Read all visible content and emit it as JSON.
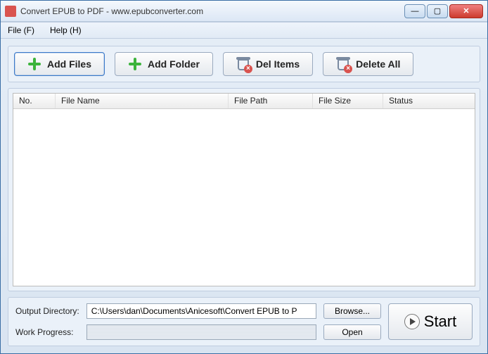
{
  "window": {
    "title": "Convert EPUB to PDF - www.epubconverter.com"
  },
  "menu": {
    "file": "File (F)",
    "help": "Help (H)"
  },
  "toolbar": {
    "add_files": "Add Files",
    "add_folder": "Add Folder",
    "del_items": "Del Items",
    "delete_all": "Delete All"
  },
  "table": {
    "headers": {
      "no": "No.",
      "name": "File Name",
      "path": "File Path",
      "size": "File Size",
      "status": "Status"
    },
    "rows": []
  },
  "bottom": {
    "output_dir_label": "Output Directory:",
    "output_dir_value": "C:\\Users\\dan\\Documents\\Anicesoft\\Convert EPUB to P",
    "browse": "Browse...",
    "work_progress_label": "Work Progress:",
    "open": "Open",
    "start": "Start"
  }
}
